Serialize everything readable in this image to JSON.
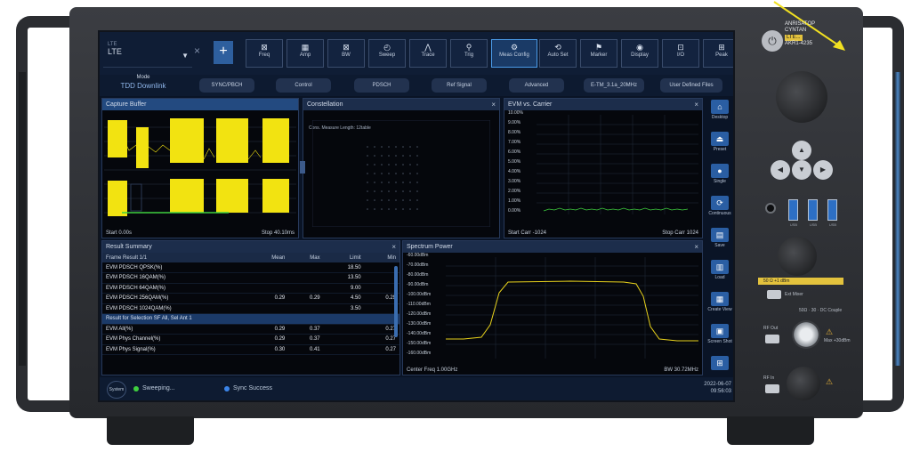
{
  "toolbar": {
    "standard_label": "LTE",
    "standard_value": "LTE",
    "close_glyph": "×",
    "add_glyph": "+",
    "buttons": [
      {
        "label": "Freq",
        "icon": "freq-icon",
        "glyph": "⊠"
      },
      {
        "label": "Amp",
        "icon": "amp-icon",
        "glyph": "▦"
      },
      {
        "label": "BW",
        "icon": "bw-icon",
        "glyph": "⊠"
      },
      {
        "label": "Sweep",
        "icon": "sweep-icon",
        "glyph": "◴"
      },
      {
        "label": "Trace",
        "icon": "trace-icon",
        "glyph": "⋀"
      },
      {
        "label": "Trig",
        "icon": "trig-icon",
        "glyph": "⚲"
      },
      {
        "label": "Meas Config",
        "icon": "meas-config-icon",
        "glyph": "⚙"
      },
      {
        "label": "Auto Set",
        "icon": "auto-set-icon",
        "glyph": "⟲"
      },
      {
        "label": "Marker",
        "icon": "marker-icon",
        "glyph": "⚑"
      },
      {
        "label": "Display",
        "icon": "display-icon",
        "glyph": "◉"
      },
      {
        "label": "I/O",
        "icon": "io-icon",
        "glyph": "⊡"
      },
      {
        "label": "Peak",
        "icon": "peak-icon",
        "glyph": "⊞"
      }
    ]
  },
  "modebar": {
    "mode_label": "Mode",
    "mode_value": "TDD Downlink",
    "buttons": [
      "SYNC/PBCH",
      "Control",
      "PDSCH",
      "Ref Signal",
      "Advanced",
      "E-TM_3.1a_20MHz",
      "User Defined Files"
    ]
  },
  "capture": {
    "title": "Capture Buffer",
    "footer_left": "Start 0.00s",
    "footer_right": "Stop 40.10ms",
    "colors": {
      "signal": "#f2e311",
      "green": "#3fcf3f"
    }
  },
  "constellation": {
    "title": "Constellation",
    "close": "×",
    "info": "Cons. Measure Length: 12table"
  },
  "evm": {
    "title": "EVM vs. Carrier",
    "close": "×",
    "yticks": [
      "10.00%",
      "9.00%",
      "8.00%",
      "7.00%",
      "6.00%",
      "5.00%",
      "4.00%",
      "3.00%",
      "2.00%",
      "1.00%",
      "0.00%"
    ],
    "footer_left": "Start Carr -1024",
    "footer_right": "Stop Carr 1024"
  },
  "result": {
    "title": "Result Summary",
    "close": "×",
    "headers": [
      "Frame Result 1/1",
      "Mean",
      "Max",
      "Limit",
      "Min"
    ],
    "rows": [
      [
        "EVM PDSCH QPSK(%)",
        "",
        "",
        "18.50",
        ""
      ],
      [
        "EVM PDSCH 16QAM(%)",
        "",
        "",
        "13.50",
        ""
      ],
      [
        "EVM PDSCH 64QAM(%)",
        "",
        "",
        "9.00",
        ""
      ],
      [
        "EVM PDSCH 256QAM(%)",
        "0.29",
        "0.29",
        "4.50",
        "0.29"
      ],
      [
        "EVM PDSCH 1024QAM(%)",
        "",
        "",
        "3.50",
        ""
      ]
    ],
    "section": "Result for Selection SF All, Sel Ant 1",
    "rows2": [
      [
        "EVM All(%)",
        "0.29",
        "0.37",
        "",
        "0.27"
      ],
      [
        "EVM Phys Channel(%)",
        "0.29",
        "0.37",
        "",
        "0.27"
      ],
      [
        "EVM Phys Signal(%)",
        "0.30",
        "0.41",
        "",
        "0.27"
      ]
    ]
  },
  "spectrum": {
    "title": "Spectrum Power",
    "close": "×",
    "yticks": [
      "-60.00dBm",
      "-70.00dBm",
      "-80.00dBm",
      "-90.00dBm",
      "-100.00dBm",
      "-110.00dBm",
      "-120.00dBm",
      "-130.00dBm",
      "-140.00dBm",
      "-150.00dBm",
      "-160.00dBm"
    ],
    "footer_left": "Center Freq 1.00GHz",
    "footer_right": "BW 30.72MHz"
  },
  "side": {
    "buttons": [
      {
        "label": "Desktop",
        "glyph": "⌂"
      },
      {
        "label": "Preset",
        "glyph": "⏏"
      },
      {
        "label": "Single",
        "glyph": "●"
      },
      {
        "label": "Continuous",
        "glyph": "⟳"
      },
      {
        "label": "Save",
        "glyph": "▤"
      },
      {
        "label": "Load",
        "glyph": "▥"
      },
      {
        "label": "Create View",
        "glyph": "▦"
      },
      {
        "label": "Screen Shot",
        "glyph": "▣"
      },
      {
        "label": "",
        "glyph": "⊞"
      }
    ]
  },
  "status": {
    "system": "System",
    "state1": "Sweeping...",
    "state2": "Sync Success",
    "date": "2022-06-07",
    "time": "09:56:03"
  },
  "front": {
    "brand_line1": "ANRISATOP",
    "brand_line2": "CYNTAN",
    "model_badge": "LTE...",
    "model": "AKR1-4235",
    "usb_labels": [
      "USB",
      "USB",
      "USB"
    ],
    "rf_out_label": "RF Out",
    "rf_in_label": "RF In",
    "strip": "50 Ω  +1 dBm",
    "ext_mixer": "Ext Mixer",
    "port_note": "50Ω · 30 · DC Couple",
    "warn_note": "Max +30dBm"
  }
}
